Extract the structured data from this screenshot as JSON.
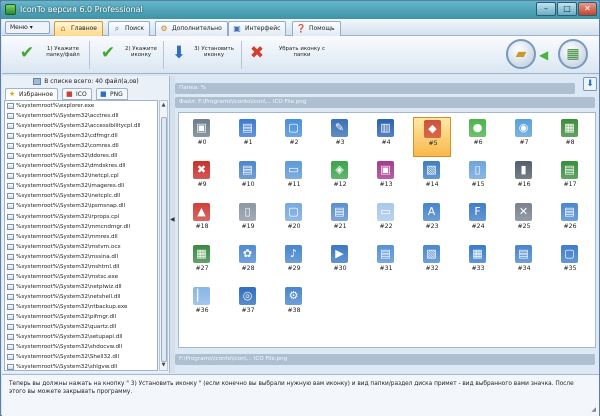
{
  "window": {
    "title": "IconTo версия 6.0 Professional",
    "btn_min": "–",
    "btn_max": "□",
    "btn_close": "✕"
  },
  "menu": {
    "label": "Меню ▾"
  },
  "tabs": [
    {
      "label": "Главное",
      "icon": "home-icon"
    },
    {
      "label": "Поиск",
      "icon": "search-icon"
    },
    {
      "label": "Дополнительно",
      "icon": "gear-icon"
    },
    {
      "label": "Интерфейс",
      "icon": "window-icon"
    },
    {
      "label": "Помощь",
      "icon": "help-icon"
    }
  ],
  "toolbar": {
    "items": [
      {
        "label": "1) Укажите папку/файл",
        "icon": "check-icon"
      },
      {
        "label": "2) Укажите иконку",
        "icon": "check-icon"
      },
      {
        "label": "3) Установить иконку",
        "icon": "install-icon"
      },
      {
        "label": "Убрать иконку с папки",
        "icon": "remove-icon"
      }
    ]
  },
  "left": {
    "count": "В списке всего: 40 файл(а,ов)",
    "tabs": [
      {
        "label": "Избранное"
      },
      {
        "label": "ICO"
      },
      {
        "label": "PNG"
      }
    ],
    "files": [
      "%systemroot%\\explorer.exe",
      "%systemroot%\\System32\\acctres.dll",
      "%systemroot%\\System32\\accessibilitycpl.dll",
      "%systemroot%\\System32\\cdfmgr.dll",
      "%systemroot%\\System32\\comres.dll",
      "%systemroot%\\System32\\ddores.dll",
      "%systemroot%\\System32\\dmdskres.dll",
      "%systemroot%\\System32\\inetcpl.cpl",
      "%systemroot%\\System32\\imageres.dll",
      "%systemroot%\\System32\\inetcplc.dll",
      "%systemroot%\\System32\\ipsmsnap.dll",
      "%systemroot%\\System32\\irprops.cpl",
      "%systemroot%\\System32\\mmcndmgr.dll",
      "%systemroot%\\System32\\mmres.dll",
      "%systemroot%\\System32\\mstvm.ocx",
      "%systemroot%\\System32\\mssina.dll",
      "%systemroot%\\System32\\mshtml.dll",
      "%systemroot%\\System32\\mstsc.exe",
      "%systemroot%\\System32\\netplwiz.dll",
      "%systemroot%\\System32\\netshell.dll",
      "%systemroot%\\System32\\ntbackup.exe",
      "%systemroot%\\System32\\pifmgr.dll",
      "%systemroot%\\System32\\quartz.dll",
      "%systemroot%\\System32\\setupapi.dll",
      "%systemroot%\\System32\\shdocvw.dll",
      "%systemroot%\\System32\\Shell32.dll",
      "%systemroot%\\System32\\shlgvw.dll"
    ]
  },
  "right": {
    "top_path": "Папка: %",
    "file_path": "Файл: F:\\Programs\\Iconto\\icon\\... ICO File.png",
    "bottom_path": "F:\\Programs\\Iconto\\icon\\... ICO File.png",
    "icons": [
      {
        "label": "#0",
        "color": "#6d7d8c",
        "glyph": "▣"
      },
      {
        "label": "#1",
        "color": "#3b7ad1",
        "glyph": "▤"
      },
      {
        "label": "#2",
        "color": "#4a8fd8",
        "glyph": "▢"
      },
      {
        "label": "#3",
        "color": "#3a6fb6",
        "glyph": "✎"
      },
      {
        "label": "#4",
        "color": "#2b63b0",
        "glyph": "▥"
      },
      {
        "label": "#5",
        "color": "#d04f3a",
        "glyph": "◆"
      },
      {
        "label": "#6",
        "color": "#4bb34a",
        "glyph": "●"
      },
      {
        "label": "#7",
        "color": "#5aa1d8",
        "glyph": "◉"
      },
      {
        "label": "#8",
        "color": "#3d8c3a",
        "glyph": "▦"
      },
      {
        "label": "#9",
        "color": "#c9302c",
        "glyph": "✖"
      },
      {
        "label": "#10",
        "color": "#4e86c9",
        "glyph": "▤"
      },
      {
        "label": "#11",
        "color": "#5d9ad9",
        "glyph": "▭"
      },
      {
        "label": "#12",
        "color": "#3aa34b",
        "glyph": "◈"
      },
      {
        "label": "#13",
        "color": "#a43b8f",
        "glyph": "▣"
      },
      {
        "label": "#14",
        "color": "#3e7ec2",
        "glyph": "▧"
      },
      {
        "label": "#15",
        "color": "#6da4de",
        "glyph": "▯"
      },
      {
        "label": "#16",
        "color": "#545e6b",
        "glyph": "▮"
      },
      {
        "label": "#17",
        "color": "#3a8f3d",
        "glyph": "▤"
      },
      {
        "label": "#18",
        "color": "#d1403a",
        "glyph": "▲"
      },
      {
        "label": "#19",
        "color": "#8b97a5",
        "glyph": "▯"
      },
      {
        "label": "#20",
        "color": "#76a9e0",
        "glyph": "▢"
      },
      {
        "label": "#21",
        "color": "#5a8fce",
        "glyph": "▤"
      },
      {
        "label": "#22",
        "color": "#a9c8ea",
        "glyph": "▭"
      },
      {
        "label": "#23",
        "color": "#4785cc",
        "glyph": "A"
      },
      {
        "label": "#24",
        "color": "#3f7ec8",
        "glyph": "F"
      },
      {
        "label": "#25",
        "color": "#7a8290",
        "glyph": "✕"
      },
      {
        "label": "#26",
        "color": "#4b88cf",
        "glyph": "▤"
      },
      {
        "label": "#27",
        "color": "#3a8a45",
        "glyph": "▦"
      },
      {
        "label": "#28",
        "color": "#4f8bd2",
        "glyph": "✿"
      },
      {
        "label": "#29",
        "color": "#4a86cc",
        "glyph": "♪"
      },
      {
        "label": "#30",
        "color": "#3c78c2",
        "glyph": "▶"
      },
      {
        "label": "#31",
        "color": "#5692d6",
        "glyph": "▤"
      },
      {
        "label": "#32",
        "color": "#4b88cf",
        "glyph": "▧"
      },
      {
        "label": "#33",
        "color": "#3a7dc6",
        "glyph": "▦"
      },
      {
        "label": "#34",
        "color": "#4a86cc",
        "glyph": "▤"
      },
      {
        "label": "#35",
        "color": "#3f7ec8",
        "glyph": "▢"
      },
      {
        "label": "#36",
        "color": "#8bb6e6",
        "glyph": "▏"
      },
      {
        "label": "#37",
        "color": "#2f6fbd",
        "glyph": "◎"
      },
      {
        "label": "#38",
        "color": "#4a86cc",
        "glyph": "⚙"
      }
    ],
    "selected_index": 5
  },
  "status": {
    "hint": "Теперь вы должны нажать на кнопку \" 3) Установить иконку \" (если конечно вы выбрали нужную вам иконку) и вид папки/раздел диска примет - вид выбранного вами значка. После этого вы можете закрывать программу."
  }
}
